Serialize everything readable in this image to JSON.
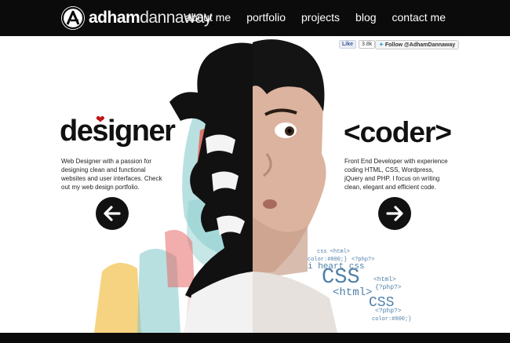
{
  "brand": {
    "bold": "adham",
    "light": "dannaway"
  },
  "nav": [
    "about me",
    "portfolio",
    "projects",
    "blog",
    "contact me"
  ],
  "social": {
    "like_label": "Like",
    "like_count": "3.8k",
    "follow_label": "Follow @AdhamDannaway"
  },
  "designer": {
    "heading": "designer",
    "description": "Web Designer with a passion for designing clean and functional websites and user interfaces. Check out my web design portfolio."
  },
  "coder": {
    "heading": "<coder>",
    "description": "Front End Developer with experience coding HTML, CSS, Wordpress, jQuery and PHP. I focus on writing clean, elegant and efficient code."
  },
  "code_words": [
    "css <html>",
    "color:#000;}",
    "<?php?>",
    "i heart css",
    "CSS",
    "<html>",
    "{?php?>",
    "<html>",
    "CSS",
    "<?php?>",
    "color:#000;}"
  ],
  "colors": {
    "topbar": "#0b0b0b",
    "heart": "#c21414",
    "accent_text": "#4e7fa8"
  }
}
